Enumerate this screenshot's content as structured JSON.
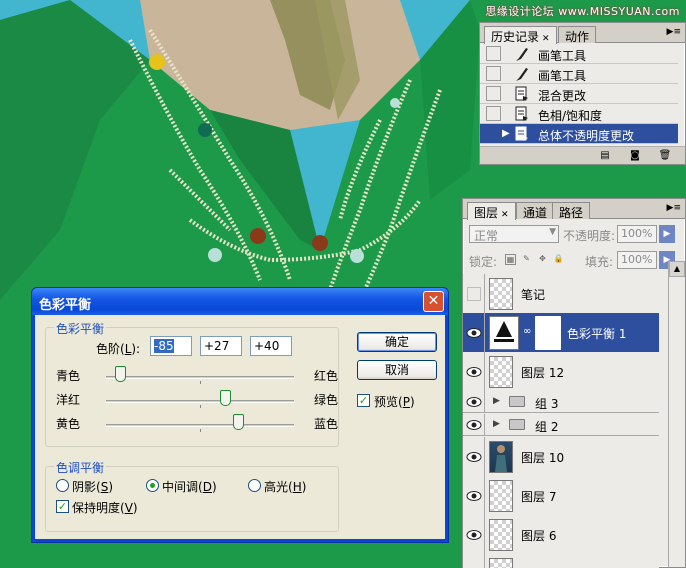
{
  "watermark": "思缘设计论坛 www.MISSYUAN.com",
  "history": {
    "tabs": [
      "历史记录",
      "动作"
    ],
    "items": [
      {
        "label": "画笔工具",
        "icon": "brush-icon",
        "selected": false
      },
      {
        "label": "画笔工具",
        "icon": "brush-icon",
        "selected": false
      },
      {
        "label": "混合更改",
        "icon": "history-state-icon",
        "selected": false
      },
      {
        "label": "色相/饱和度",
        "icon": "history-state-icon",
        "selected": false
      },
      {
        "label": "总体不透明度更改",
        "icon": "history-state-icon",
        "selected": true
      }
    ]
  },
  "layers": {
    "tabs": [
      "图层",
      "通道",
      "路径"
    ],
    "blend_mode": "正常",
    "opacity_label": "不透明度:",
    "opacity_value": "100%",
    "lock_label": "锁定:",
    "fill_label": "填充:",
    "fill_value": "100%",
    "items": [
      {
        "name": "笔记",
        "visible": false,
        "type": "layer"
      },
      {
        "name": "色彩平衡 1",
        "visible": true,
        "type": "adjustment",
        "selected": true
      },
      {
        "name": "图层 12",
        "visible": true,
        "type": "layer"
      },
      {
        "name": "组 3",
        "visible": true,
        "type": "group"
      },
      {
        "name": "组 2",
        "visible": true,
        "type": "group"
      },
      {
        "name": "图层 10",
        "visible": true,
        "type": "photo"
      },
      {
        "name": "图层 7",
        "visible": true,
        "type": "layer"
      },
      {
        "name": "图层 6",
        "visible": true,
        "type": "layer"
      }
    ]
  },
  "dialog": {
    "title": "色彩平衡",
    "color_balance_group": "色彩平衡",
    "levels_label": "色阶(",
    "levels_hotkey": "L",
    "levels_suffix": "):",
    "levels": [
      "-85",
      "+27",
      "+40"
    ],
    "sliders": [
      {
        "left": "青色",
        "right": "红色",
        "value": -85
      },
      {
        "left": "洋红",
        "right": "绿色",
        "value": 27
      },
      {
        "left": "黄色",
        "right": "蓝色",
        "value": 40
      }
    ],
    "tone_group": "色调平衡",
    "tones": [
      {
        "label": "阴影(",
        "hotkey": "S",
        "suffix": ")",
        "checked": false
      },
      {
        "label": "中间调(",
        "hotkey": "D",
        "suffix": ")",
        "checked": true
      },
      {
        "label": "高光(",
        "hotkey": "H",
        "suffix": ")",
        "checked": false
      }
    ],
    "preserve_label": "保持明度(",
    "preserve_hotkey": "V",
    "preserve_suffix": ")",
    "preserve_checked": true,
    "ok": "确定",
    "cancel": "取消",
    "preview_label": "预览(",
    "preview_hotkey": "P",
    "preview_suffix": ")",
    "preview_checked": true
  },
  "colors": {
    "selection_blue": "#2d4f9d",
    "dress_green": "#1c9a4a",
    "background_cyan": "#3fb6cf"
  }
}
